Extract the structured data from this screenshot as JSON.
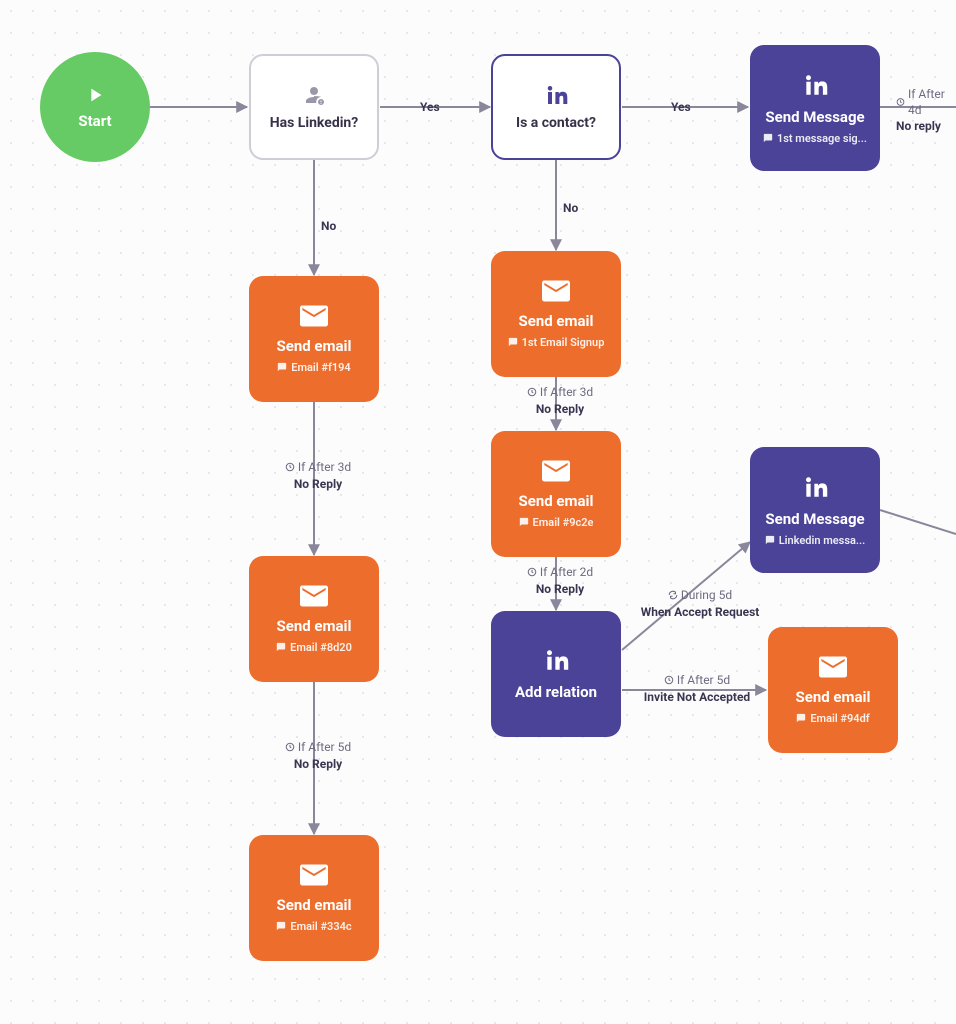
{
  "nodes": {
    "start": {
      "label": "Start"
    },
    "has_linkedin": {
      "label": "Has Linkedin?"
    },
    "is_contact": {
      "label": "Is a contact?"
    },
    "send_msg_1": {
      "title": "Send Message",
      "sub": "1st message sig..."
    },
    "send_email_f194": {
      "title": "Send email",
      "sub": "Email #f194"
    },
    "send_email_1st": {
      "title": "Send email",
      "sub": "1st Email Signup"
    },
    "send_email_9c2e": {
      "title": "Send email",
      "sub": "Email #9c2e"
    },
    "send_email_8d20": {
      "title": "Send email",
      "sub": "Email #8d20"
    },
    "add_relation": {
      "title": "Add relation"
    },
    "send_msg_li": {
      "title": "Send Message",
      "sub": "Linkedin messa..."
    },
    "send_email_94df": {
      "title": "Send email",
      "sub": "Email #94df"
    },
    "send_email_334c": {
      "title": "Send email",
      "sub": "Email #334c"
    }
  },
  "edges": {
    "start_has_linkedin": {
      "label": ""
    },
    "has_linkedin_yes": {
      "label": "Yes"
    },
    "is_contact_yes": {
      "label": "Yes"
    },
    "send_msg_1_right": {
      "cond": "If After 4d",
      "out": "No reply"
    },
    "has_linkedin_no": {
      "label": "No"
    },
    "is_contact_no": {
      "label": "No"
    },
    "f194_down": {
      "cond": "If After 3d",
      "out": "No Reply"
    },
    "first_down": {
      "cond": "If After 3d",
      "out": "No Reply"
    },
    "c9c2e_down": {
      "cond": "If After 2d",
      "out": "No Reply"
    },
    "d8d20_down": {
      "cond": "If After 5d",
      "out": "No Reply"
    },
    "rel_accept": {
      "cond": "During 5d",
      "out": "When Accept Request"
    },
    "rel_noaccept": {
      "cond": "If After 5d",
      "out": "Invite Not Accepted"
    }
  }
}
